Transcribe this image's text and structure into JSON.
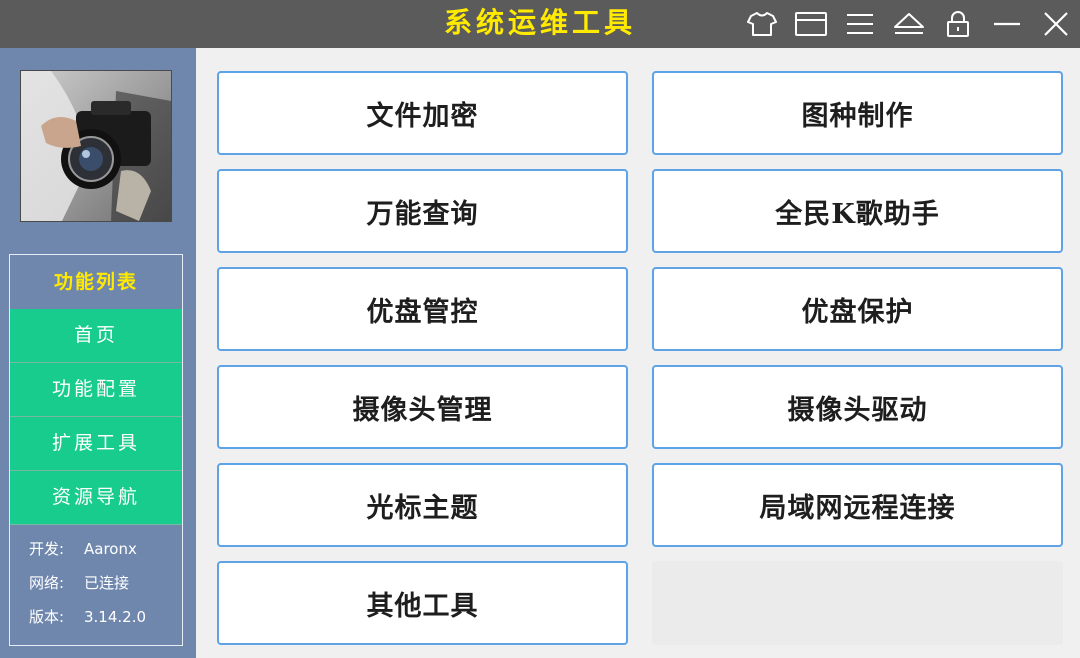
{
  "app": {
    "title": "系统运维工具"
  },
  "titlebar_icons": [
    {
      "name": "skin-icon"
    },
    {
      "name": "window-icon"
    },
    {
      "name": "menu-icon"
    },
    {
      "name": "eject-icon"
    },
    {
      "name": "lock-icon"
    },
    {
      "name": "minimize-icon"
    },
    {
      "name": "close-icon"
    }
  ],
  "sidebar": {
    "panel_title": "功能列表",
    "nav": [
      "首页",
      "功能配置",
      "扩展工具",
      "资源导航"
    ],
    "info": [
      {
        "label": "开发:",
        "value": "Aaronx"
      },
      {
        "label": "网络:",
        "value": "已连接"
      },
      {
        "label": "版本:",
        "value": "3.14.2.0"
      }
    ]
  },
  "functions": [
    "文件加密",
    "图种制作",
    "万能查询",
    "全民K歌助手",
    "优盘管控",
    "优盘保护",
    "摄像头管理",
    "摄像头驱动",
    "光标主题",
    "局域网远程连接",
    "其他工具"
  ],
  "colors": {
    "titlebar": "#5b5b5b",
    "title_text": "#ffea00",
    "sidebar": "#6f87ad",
    "nav_active": "#17cc8c",
    "button_border": "#5fa2e6"
  }
}
